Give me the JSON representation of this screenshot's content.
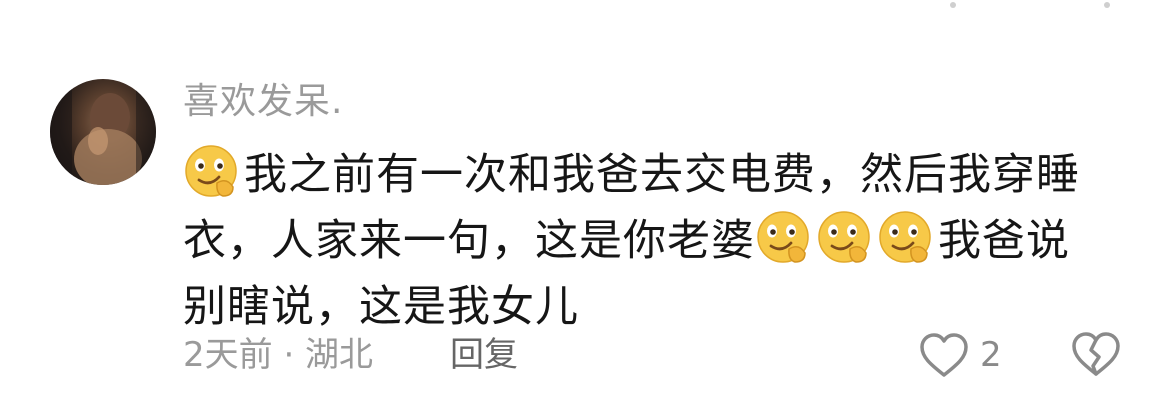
{
  "comment": {
    "username": "喜欢发呆.",
    "content": {
      "line1": "我之前有一次和我爸去交电费，然后我穿睡",
      "line2_a": "衣，人家来一句，这是你老婆",
      "line2_b": "我爸说",
      "line3": "别瞎说，这是我女儿"
    },
    "emojis": [
      "smirk-thinking-emoji",
      "smirk-thinking-emoji",
      "smirk-thinking-emoji",
      "smirk-thinking-emoji"
    ],
    "meta": "2天前 · 湖北",
    "reply_label": "回复",
    "like_count": "2"
  },
  "colors": {
    "username": "#9a9a9a",
    "text": "#161616",
    "meta": "#9a9a9a",
    "reply": "#666666",
    "icon": "#8a8a8a",
    "emoji_face": "#f7c948"
  }
}
